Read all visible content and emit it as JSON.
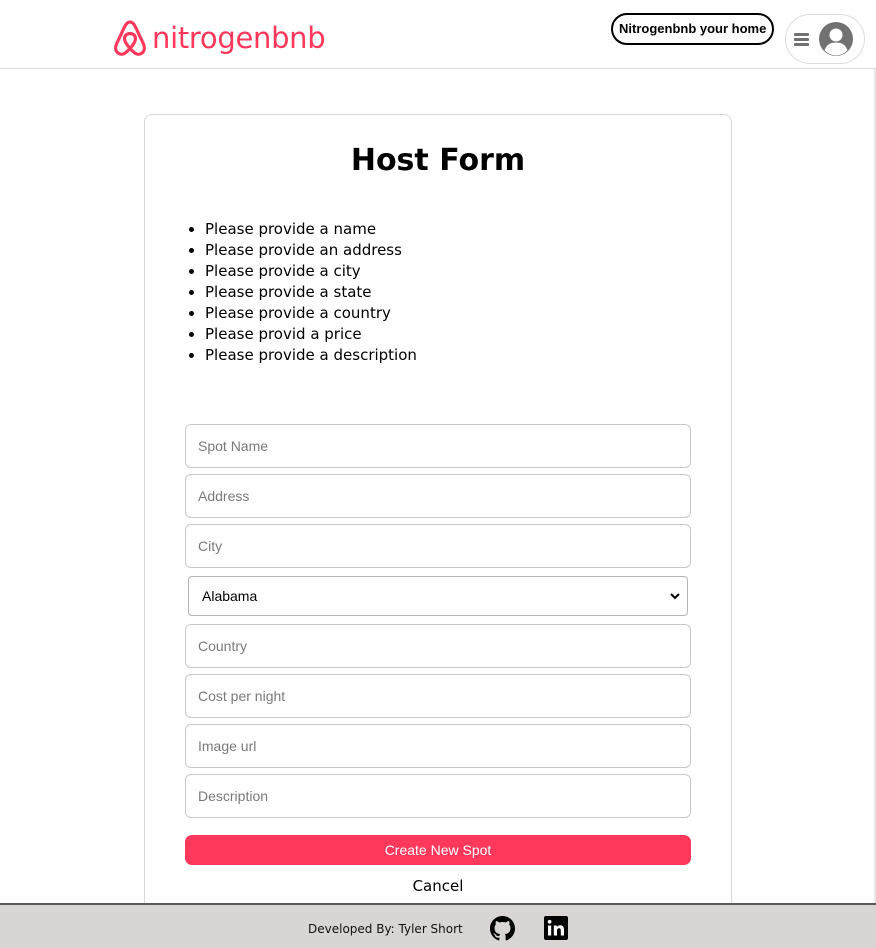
{
  "header": {
    "logo_text": "nitrogenbnb",
    "host_button": "Nitrogenbnb your home",
    "brand_color": "#ff385c"
  },
  "form": {
    "title": "Host Form",
    "errors": [
      "Please provide a name",
      "Please provide an address",
      "Please provide a city",
      "Please provide a state",
      "Please provide a country",
      "Please provid a price",
      "Please provide a description"
    ],
    "fields": {
      "spot_name": {
        "placeholder": "Spot Name",
        "value": ""
      },
      "address": {
        "placeholder": "Address",
        "value": ""
      },
      "city": {
        "placeholder": "City",
        "value": ""
      },
      "state": {
        "selected": "Alabama"
      },
      "country": {
        "placeholder": "Country",
        "value": ""
      },
      "price": {
        "placeholder": "Cost per night",
        "value": ""
      },
      "image_url": {
        "placeholder": "Image url",
        "value": ""
      },
      "description": {
        "placeholder": "Description",
        "value": ""
      }
    },
    "create_button": "Create New Spot",
    "cancel_button": "Cancel"
  },
  "footer": {
    "developer_text": "Developed By: Tyler Short",
    "icons": [
      "github-icon",
      "linkedin-icon"
    ]
  }
}
